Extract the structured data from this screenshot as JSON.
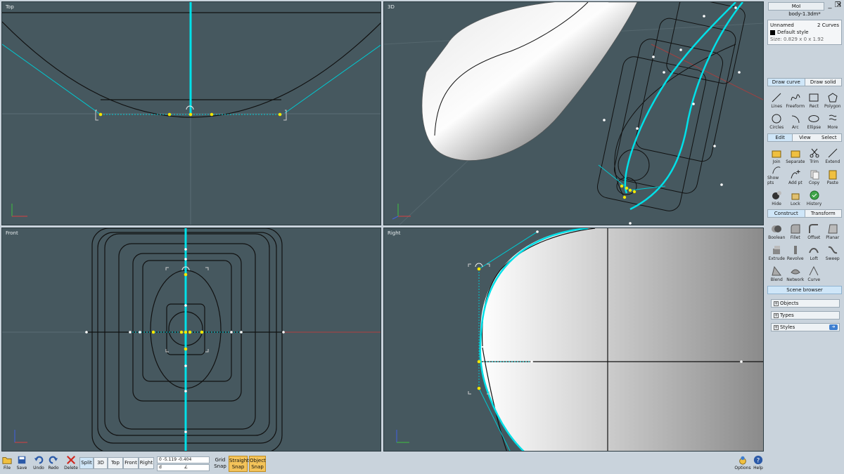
{
  "app": {
    "title": "MoI",
    "file_name": "body-1.3dm*"
  },
  "viewports": {
    "top": "Top",
    "three_d": "3D",
    "front": "Front",
    "right": "Right"
  },
  "axes": {
    "x": "x",
    "y": "y",
    "z": "z"
  },
  "object_info": {
    "name": "Unnamed",
    "count": "2 Curves",
    "style": "Default style",
    "size": "Size: 0.829 x 0 x 1.92"
  },
  "draw_tabs": {
    "curve": "Draw curve",
    "solid": "Draw solid"
  },
  "draw_tools": [
    {
      "label": "Lines",
      "icon": "lines-icon"
    },
    {
      "label": "Freeform",
      "icon": "freeform-icon"
    },
    {
      "label": "Rect",
      "icon": "rect-icon"
    },
    {
      "label": "Polygon",
      "icon": "polygon-icon"
    },
    {
      "label": "Circles",
      "icon": "circle-icon"
    },
    {
      "label": "Arc",
      "icon": "arc-icon"
    },
    {
      "label": "Ellipse",
      "icon": "ellipse-icon"
    },
    {
      "label": "More",
      "icon": "more-icon"
    }
  ],
  "edit_tabs": {
    "edit": "Edit",
    "view": "View",
    "select": "Select"
  },
  "edit_tools": [
    {
      "label": "Join"
    },
    {
      "label": "Separate"
    },
    {
      "label": "Trim"
    },
    {
      "label": "Extend"
    },
    {
      "label": "Show pts"
    },
    {
      "label": "Add pt"
    },
    {
      "label": "Copy"
    },
    {
      "label": "Paste"
    },
    {
      "label": "Hide"
    },
    {
      "label": "Lock"
    },
    {
      "label": "History"
    }
  ],
  "construct_tabs": {
    "construct": "Construct",
    "transform": "Transform"
  },
  "construct_tools": [
    {
      "label": "Boolean"
    },
    {
      "label": "Fillet"
    },
    {
      "label": "Offset"
    },
    {
      "label": "Planar"
    },
    {
      "label": "Extrude"
    },
    {
      "label": "Revolve"
    },
    {
      "label": "Loft"
    },
    {
      "label": "Sweep"
    },
    {
      "label": "Blend"
    },
    {
      "label": "Network"
    },
    {
      "label": "Curve"
    }
  ],
  "scene_browser": {
    "title": "Scene browser",
    "objects": "Objects",
    "types": "Types",
    "styles": "Styles"
  },
  "bottom": {
    "file": "File",
    "save": "Save",
    "undo": "Undo",
    "redo": "Redo",
    "delete": "Delete",
    "views": [
      "Split",
      "3D",
      "Top",
      "Front",
      "Right"
    ],
    "coord_line1": "0        -5.119  -0.404",
    "coord_d": "d",
    "coord_angle": "∠",
    "grid_snap": [
      "Grid",
      "Snap"
    ],
    "straight_snap": [
      "Straight",
      "Snap"
    ],
    "object_snap": [
      "Object",
      "Snap"
    ],
    "options": "Options",
    "help": "Help"
  },
  "colors": {
    "viewport_bg": "#46585f",
    "curve": "#00e0e8",
    "point": "#f2e600",
    "panel": "#c9d3dc",
    "accent_tab": "#cfe6f8",
    "snap_on": "#f3c35a"
  }
}
